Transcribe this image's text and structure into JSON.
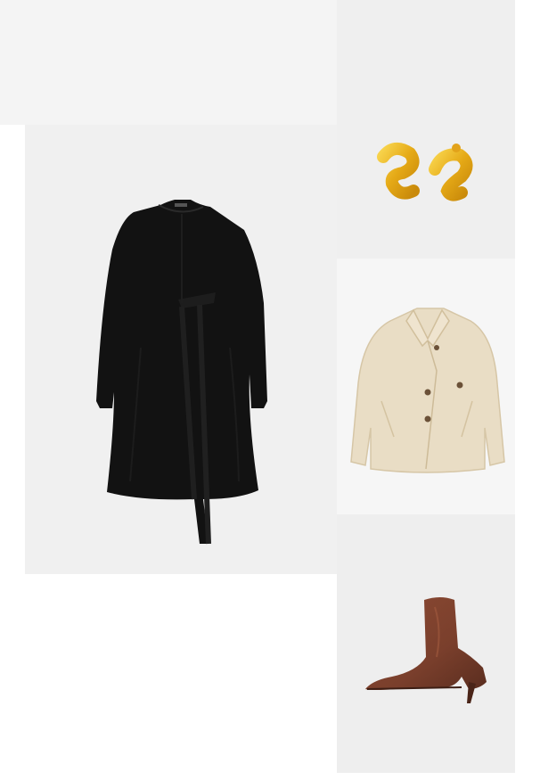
{
  "outfit": {
    "items": [
      {
        "name": "dress",
        "color": "#111111"
      },
      {
        "name": "earrings",
        "color": "#e8b320"
      },
      {
        "name": "jacket",
        "color": "#e8dcc4"
      },
      {
        "name": "boot",
        "color": "#7a3f2c"
      }
    ],
    "background_colors": {
      "top_left": "#f4f4f4",
      "dress_tile": "#f0f0f0",
      "earrings_tile": "#efefef",
      "jacket_tile": "#f6f6f6",
      "boot_tile": "#eeeeee"
    }
  }
}
